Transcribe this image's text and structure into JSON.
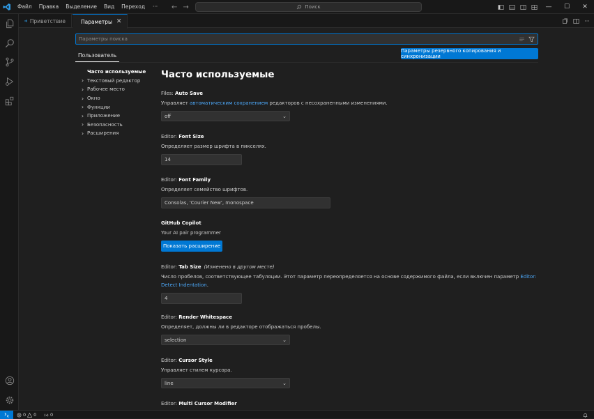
{
  "titlebar": {
    "menus": [
      "Файл",
      "Правка",
      "Выделение",
      "Вид",
      "Переход"
    ],
    "more": "···",
    "search_label": "Поиск",
    "back_arrow": "←",
    "forward_arrow": "→",
    "minimize": "—",
    "maximize": "☐",
    "close": "✕"
  },
  "tabs": [
    {
      "label": "Приветствие",
      "active": false
    },
    {
      "label": "Параметры",
      "active": true
    }
  ],
  "tab_close": "✕",
  "settings": {
    "search_placeholder": "Параметры поиска",
    "scope_tab": "Пользователь",
    "sync_button": "Параметры резервного копирования и синхронизации",
    "toc": {
      "selected": "Часто используемые",
      "items": [
        "Текстовый редактор",
        "Рабочее место",
        "Окно",
        "Функции",
        "Приложение",
        "Безопасность",
        "Расширения"
      ]
    },
    "section_title": "Часто используемые",
    "items": {
      "auto_save": {
        "category": "Files: ",
        "name": "Auto Save",
        "desc_before": "Управляет ",
        "desc_link": "автоматическим сохранением",
        "desc_after": " редакторов с несохраненными изменениями.",
        "value": "off"
      },
      "font_size": {
        "category": "Editor: ",
        "name": "Font Size",
        "desc": "Определяет размер шрифта в пикселях.",
        "value": "14"
      },
      "font_family": {
        "category": "Editor: ",
        "name": "Font Family",
        "desc": "Определяет семейство шрифтов.",
        "value": "Consolas, 'Courier New', monospace"
      },
      "copilot": {
        "name": "GitHub Copilot",
        "desc": "Your AI pair programmer",
        "button": "Показать расширение"
      },
      "tab_size": {
        "category": "Editor: ",
        "name": "Tab Size",
        "modified": "(Изменено в другом месте)",
        "desc_before": "Число пробелов, соответствующее табуляции. Этот параметр переопределяется на основе содержимого файла, если включен параметр ",
        "desc_link": "Editor: Detect Indentation",
        "desc_after": ".",
        "value": "4"
      },
      "render_whitespace": {
        "category": "Editor: ",
        "name": "Render Whitespace",
        "desc": "Определяет, должны ли в редакторе отображаться пробелы.",
        "value": "selection"
      },
      "cursor_style": {
        "category": "Editor: ",
        "name": "Cursor Style",
        "desc": "Управляет стилем курсора.",
        "value": "line"
      },
      "multi_cursor": {
        "category": "Editor: ",
        "name": "Multi Cursor Modifier"
      }
    }
  },
  "statusbar": {
    "errors": "0",
    "warnings": "0",
    "ports": "0"
  },
  "colors": {
    "accent": "#0078d4",
    "link": "#4daafc",
    "background": "#1f1f1f"
  }
}
